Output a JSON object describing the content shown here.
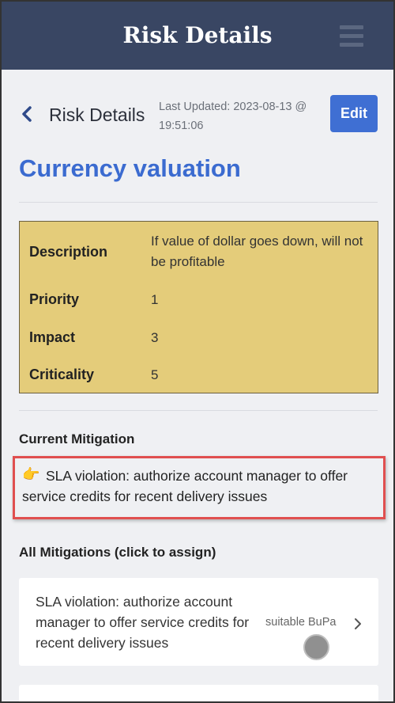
{
  "header": {
    "title": "Risk Details"
  },
  "subheader": {
    "title": "Risk Details",
    "last_updated": "Last Updated: 2023-08-13 @ 19:51:06",
    "edit_label": "Edit"
  },
  "risk": {
    "title": "Currency valuation",
    "details": [
      {
        "label": "Description",
        "value": "If value of dollar goes down, will not be profitable"
      },
      {
        "label": "Priority",
        "value": "1"
      },
      {
        "label": "Impact",
        "value": "3"
      },
      {
        "label": "Criticality",
        "value": "5"
      }
    ]
  },
  "current_mitigation": {
    "heading": "Current Mitigation",
    "icon": "pointing-hand-emoji",
    "text": "SLA violation: authorize account manager to offer service credits for recent delivery issues"
  },
  "all_mitigations": {
    "heading": "All Mitigations (click to assign)",
    "items": [
      {
        "text": "SLA violation: authorize account manager to offer service credits for recent delivery issues",
        "assignee": "suitable BuPa"
      }
    ]
  },
  "colors": {
    "header_bg": "#394663",
    "accent": "#3b6bd0",
    "detail_box_bg": "#e4cc7a",
    "highlight_border": "#e04f4f"
  }
}
